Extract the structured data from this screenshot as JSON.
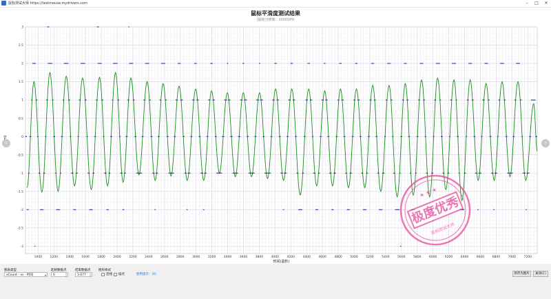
{
  "window": {
    "title": "鼠标测试大师 https://testmouse.mydrivers.com"
  },
  "chart_data": {
    "type": "line",
    "title": "鼠标平滑度测试结果",
    "subtitle": "(鼠标分辨率：1000DPI)",
    "xlabel": "时间(毫秒)",
    "ylabel": "x(cm)",
    "xlim": [
      840,
      7320
    ],
    "ylim": [
      -3.2,
      3.0
    ],
    "x_ticks": [
      1000,
      1200,
      1400,
      1600,
      1800,
      2000,
      2200,
      2400,
      2600,
      2800,
      3000,
      3200,
      3400,
      3600,
      3800,
      4000,
      4200,
      4400,
      4600,
      4800,
      5000,
      5200,
      5400,
      5600,
      5800,
      6000,
      6200,
      6400,
      6600,
      6800,
      7000,
      7200
    ],
    "y_ticks": [
      -3,
      -2.5,
      -2,
      -1.5,
      -1,
      -0.5,
      0,
      0.5,
      1,
      1.5,
      2,
      2.5,
      3
    ],
    "grid": true,
    "series": [
      {
        "style": "line",
        "color": "#1a8c1a",
        "peaks": [
          [
            860,
            -1.4
          ],
          [
            947,
            1.5
          ],
          [
            1048,
            -1.52
          ],
          [
            1149,
            1.75
          ],
          [
            1253,
            -1.5
          ],
          [
            1356,
            1.65
          ],
          [
            1461,
            -1.35
          ],
          [
            1563,
            1.6
          ],
          [
            1673,
            -1.45
          ],
          [
            1777,
            1.62
          ],
          [
            1879,
            -1.35
          ],
          [
            1980,
            1.75
          ],
          [
            2076,
            -1.25
          ],
          [
            2175,
            1.6
          ],
          [
            2277,
            -1.05
          ],
          [
            2380,
            1.5
          ],
          [
            2482,
            -1.2
          ],
          [
            2583,
            1.45
          ],
          [
            2683,
            -1.08
          ],
          [
            2785,
            1.38
          ],
          [
            2888,
            -1.2
          ],
          [
            2995,
            1.3
          ],
          [
            3097,
            -1.2
          ],
          [
            3196,
            1.25
          ],
          [
            3296,
            -1.0
          ],
          [
            3396,
            1.2
          ],
          [
            3497,
            -1.1
          ],
          [
            3598,
            1.2
          ],
          [
            3702,
            -1.1
          ],
          [
            3804,
            1.2
          ],
          [
            3905,
            -1.15
          ],
          [
            4007,
            1.3
          ],
          [
            4108,
            -1.2
          ],
          [
            4213,
            1.3
          ],
          [
            4319,
            -1.6
          ],
          [
            4426,
            1.3
          ],
          [
            4527,
            -1.35
          ],
          [
            4629,
            1.25
          ],
          [
            4728,
            -1.35
          ],
          [
            4829,
            1.3
          ],
          [
            4930,
            -1.4
          ],
          [
            5031,
            1.3
          ],
          [
            5136,
            -1.4
          ],
          [
            5237,
            1.4
          ],
          [
            5339,
            -1.5
          ],
          [
            5444,
            1.4
          ],
          [
            5546,
            -1.65
          ],
          [
            5649,
            1.45
          ],
          [
            5750,
            -1.6
          ],
          [
            5856,
            1.55
          ],
          [
            5958,
            -1.65
          ],
          [
            6058,
            1.6
          ],
          [
            6163,
            -1.45
          ],
          [
            6266,
            1.55
          ],
          [
            6367,
            -1.75
          ],
          [
            6471,
            1.55
          ],
          [
            6572,
            -1.2
          ],
          [
            6672,
            1.45
          ],
          [
            6775,
            -1.2
          ],
          [
            6875,
            1.5
          ],
          [
            6975,
            -1.1
          ],
          [
            7076,
            1.5
          ],
          [
            7175,
            -1.2
          ],
          [
            7275,
            0.9
          ],
          [
            7320,
            -0.4
          ]
        ]
      },
      {
        "style": "markers",
        "color": "#1a1aa0",
        "y_levels": [
          -2,
          -1,
          0,
          1,
          2
        ],
        "outliers": [
          [
            1120,
            3
          ],
          [
            1135,
            3
          ],
          [
            1750,
            3
          ],
          [
            1765,
            3
          ],
          [
            2150,
            3
          ],
          [
            960,
            -3
          ],
          [
            5590,
            -3
          ]
        ]
      }
    ]
  },
  "controls": {
    "chart_type_label": "图表类型",
    "chart_type_value": "xCount - vs - 时间",
    "start_label": "起始数据点",
    "start_value": "0",
    "end_label": "结束数据点",
    "end_value": "3,677",
    "display_label": "图形样式",
    "link_label": "连线",
    "dot_label": "描点",
    "help_link": "使用提示：(8)",
    "save_button": "另存为图片",
    "close_button": "关闭(C)"
  },
  "stamp": {
    "main_text": "极度优秀",
    "ring_text": "鼠标测试大师"
  },
  "colors": {
    "line": "#1a8c1a",
    "markers": "#1a1aa0",
    "stamp": "#e84b9b"
  }
}
